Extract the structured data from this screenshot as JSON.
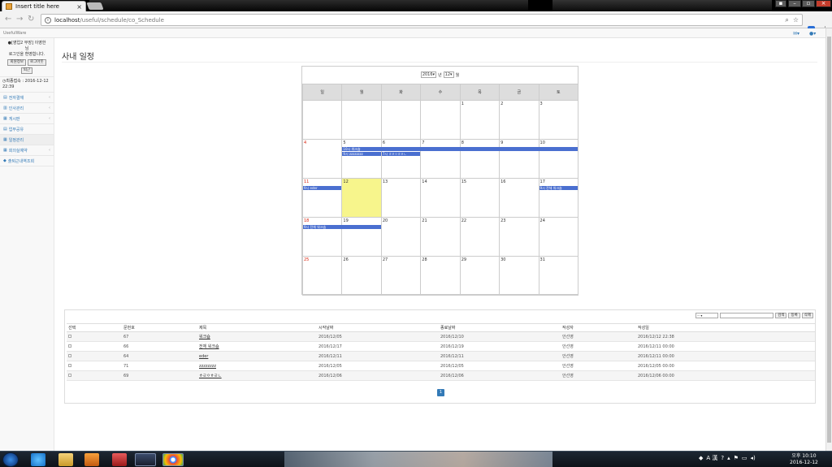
{
  "browser": {
    "tab_title": "Insert title here",
    "url_host": "localhost",
    "url_path": "/useful/schedule/co_Schedule"
  },
  "app": {
    "brand": "UsefulWare"
  },
  "sidebar": {
    "welcome_line1": "[영업2 부장] 이영한",
    "welcome_line2": "님",
    "welcome_line3": "로그인을 환영합니다.",
    "btn_info": "회원정보",
    "btn_logout": "로그아웃",
    "btn_exit": "퇴근",
    "last_login": "최종접속 : 2016-12-12 22:39",
    "items": [
      {
        "label": "전자결재",
        "icon": "document-icon",
        "arrow": "‹"
      },
      {
        "label": "인사관리",
        "icon": "chart-icon",
        "arrow": "‹"
      },
      {
        "label": "게시판",
        "icon": "list-icon",
        "arrow": "‹"
      },
      {
        "label": "업무공유",
        "icon": "share-icon",
        "arrow": ""
      },
      {
        "label": "일정관리",
        "icon": "calendar-icon",
        "arrow": ""
      },
      {
        "label": "회의실예약",
        "icon": "calendar-icon",
        "arrow": "‹"
      },
      {
        "label": "출퇴근내역조회",
        "icon": "clock-icon",
        "arrow": ""
      }
    ]
  },
  "page": {
    "title": "사내 일정"
  },
  "calendar": {
    "year": "2016",
    "year_suffix": "년",
    "month": "12",
    "month_suffix": "월",
    "weekdays": [
      "일",
      "월",
      "화",
      "수",
      "목",
      "금",
      "토"
    ],
    "weeks": [
      [
        "",
        "",
        "",
        "",
        "1",
        "2",
        "3"
      ],
      [
        "4",
        "5",
        "6",
        "7",
        "8",
        "9",
        "10"
      ],
      [
        "11",
        "12",
        "13",
        "14",
        "15",
        "16",
        "17"
      ],
      [
        "18",
        "19",
        "20",
        "21",
        "22",
        "23",
        "24"
      ],
      [
        "25",
        "26",
        "27",
        "28",
        "29",
        "30",
        "31"
      ]
    ],
    "today": "12",
    "events": [
      {
        "week": 1,
        "col_start": 1,
        "col_end": 6,
        "row": 0,
        "label": "10시 워크숍"
      },
      {
        "week": 1,
        "col_start": 1,
        "col_end": 1,
        "row": 1,
        "label": "9시 zzzzzzzz"
      },
      {
        "week": 1,
        "col_start": 2,
        "col_end": 2,
        "row": 1,
        "label": "7시 ㅎㄹㅇㅎㄹㄴ"
      },
      {
        "week": 2,
        "col_start": 0,
        "col_end": 0,
        "row": 0,
        "label": "9시 eder"
      },
      {
        "week": 2,
        "col_start": 6,
        "col_end": 6,
        "row": 0,
        "label": "9시 전체 워크숍"
      },
      {
        "week": 3,
        "col_start": 0,
        "col_end": 1,
        "row": 0,
        "label": "9시 전체 워크숍"
      }
    ]
  },
  "list": {
    "filter_select": "--",
    "search_placeholder": "",
    "btn_search": "검색",
    "btn_add": "등록",
    "btn_delete": "삭제",
    "columns": [
      "선택",
      "문번호",
      "제목",
      "시작날짜",
      "종료날짜",
      "작성자",
      "작성일"
    ],
    "rows": [
      {
        "no": "67",
        "title": "워크숍",
        "start": "2016/12/05",
        "end": "2016/12/10",
        "author": "안선영",
        "created": "2016/12/12 22:38"
      },
      {
        "no": "66",
        "title": "전체 워크숍",
        "start": "2016/12/17",
        "end": "2016/12/19",
        "author": "안선영",
        "created": "2016/12/11 00:00"
      },
      {
        "no": "64",
        "title": "eder",
        "start": "2016/12/11",
        "end": "2016/12/11",
        "author": "안선영",
        "created": "2016/12/11 00:00"
      },
      {
        "no": "71",
        "title": "zzzzzzzz",
        "start": "2016/12/05",
        "end": "2016/12/05",
        "author": "안선영",
        "created": "2016/12/05 00:00"
      },
      {
        "no": "69",
        "title": "ㅎㄹㅇㅎㄹㄴ",
        "start": "2016/12/06",
        "end": "2016/12/06",
        "author": "안선영",
        "created": "2016/12/06 00:00"
      }
    ],
    "page": "1"
  },
  "taskbar": {
    "clock_time": "오후 10:10",
    "clock_date": "2016-12-12",
    "ime": "A 漢"
  }
}
